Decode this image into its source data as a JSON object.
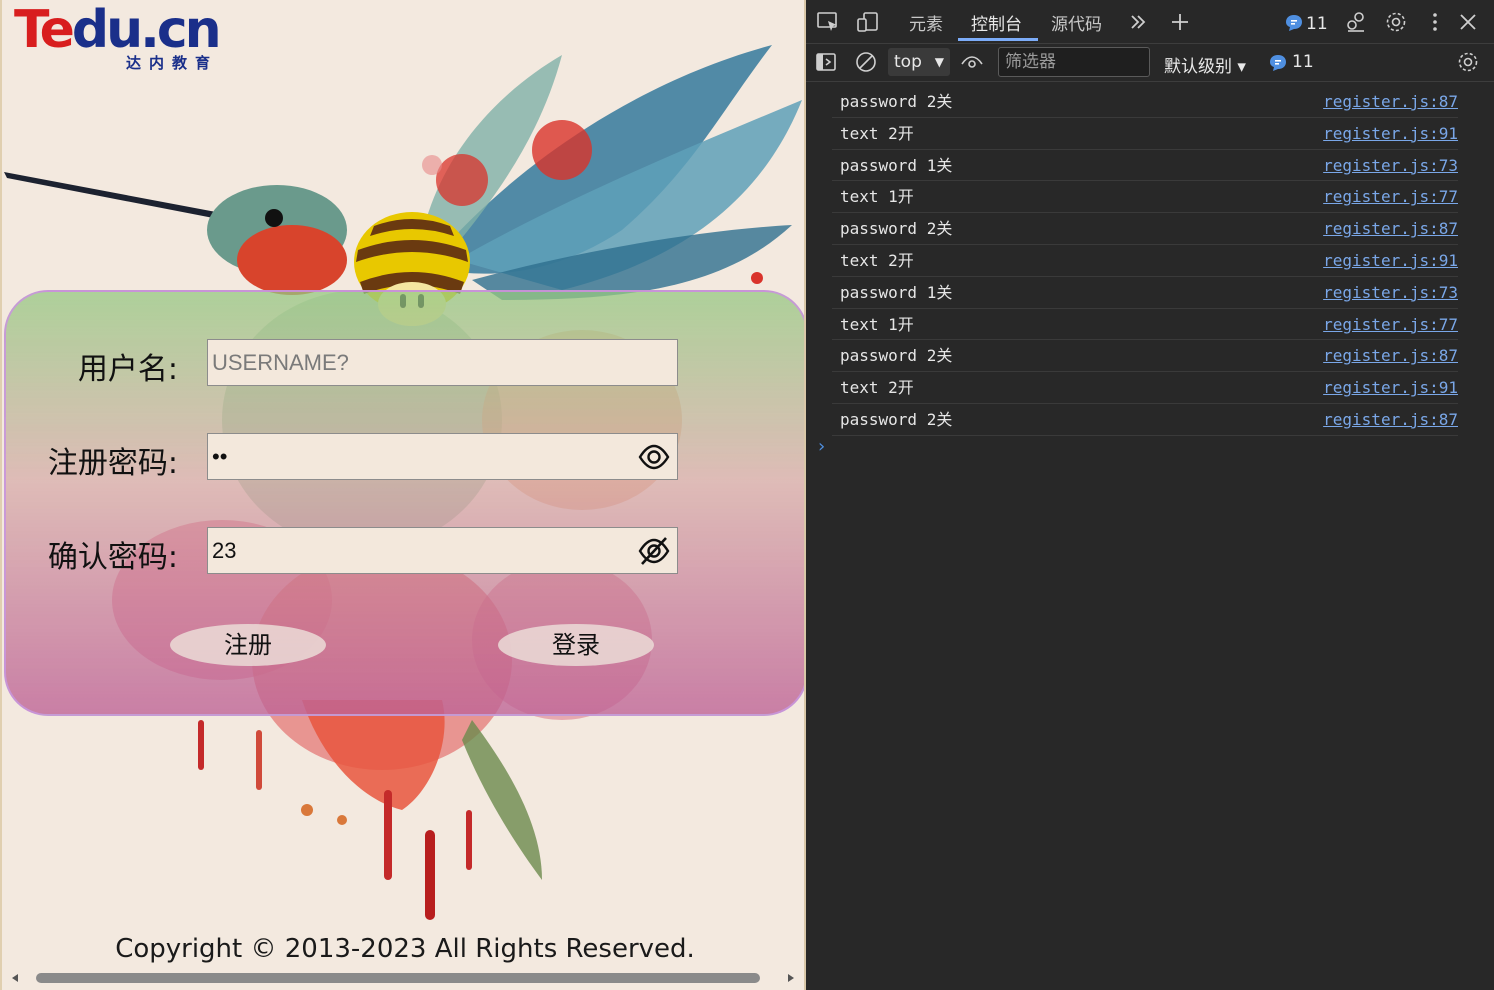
{
  "page": {
    "logo": {
      "brand_t": "Te",
      "brand_rest": "du.cn",
      "subtitle": "达内教育"
    },
    "form": {
      "username_label": "用户名:",
      "username_placeholder": "USERNAME?",
      "password_label": "注册密码:",
      "password_value": "••",
      "confirm_label": "确认密码:",
      "confirm_value": "23",
      "register_button": "注册",
      "login_button": "登录"
    },
    "copyright": "Copyright © 2013-2023 All Rights Reserved."
  },
  "devtools": {
    "tabs": [
      "元素",
      "控制台",
      "源代码"
    ],
    "active_tab": "控制台",
    "issues_count": "11",
    "context": "top",
    "filter_placeholder": "筛选器",
    "levels_label": "默认级别 ▾",
    "message_count": "11",
    "logs": [
      {
        "msg": "password 2关",
        "src": "register.js:87"
      },
      {
        "msg": "text 2开",
        "src": "register.js:91"
      },
      {
        "msg": "password 1关",
        "src": "register.js:73"
      },
      {
        "msg": "text 1开",
        "src": "register.js:77"
      },
      {
        "msg": "password 2关",
        "src": "register.js:87"
      },
      {
        "msg": "text 2开",
        "src": "register.js:91"
      },
      {
        "msg": "password 1关",
        "src": "register.js:73"
      },
      {
        "msg": "text 1开",
        "src": "register.js:77"
      },
      {
        "msg": "password 2关",
        "src": "register.js:87"
      },
      {
        "msg": "text 2开",
        "src": "register.js:91"
      },
      {
        "msg": "password 2关",
        "src": "register.js:87"
      }
    ],
    "prompt": "›"
  },
  "colors": {
    "page_bg": "#f3e9df",
    "devtools_bg": "#282828",
    "link": "#7aa7e8",
    "accent": "#4f8fe0"
  }
}
